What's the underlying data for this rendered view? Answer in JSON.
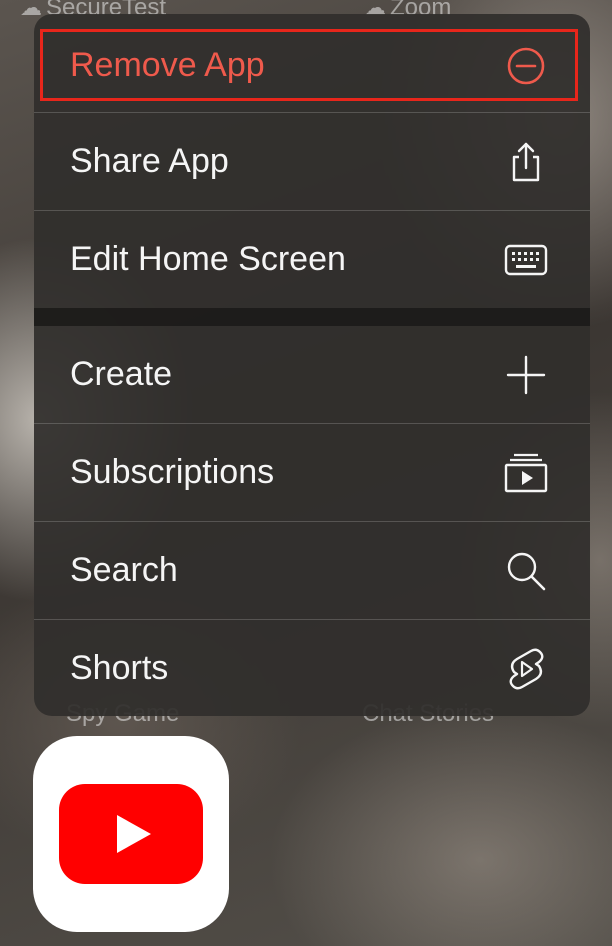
{
  "background_apps": {
    "top_left": "SecureTest",
    "top_right": "Zoom",
    "bottom_left": "Spy Game",
    "bottom_right": "Chat Stories"
  },
  "menu": {
    "items": [
      {
        "label": "Remove App",
        "icon": "minus-circle-icon",
        "destructive": true
      },
      {
        "label": "Share App",
        "icon": "share-icon"
      },
      {
        "label": "Edit Home Screen",
        "icon": "keyboard-icon"
      },
      {
        "label": "Create",
        "icon": "plus-icon"
      },
      {
        "label": "Subscriptions",
        "icon": "subscriptions-icon"
      },
      {
        "label": "Search",
        "icon": "search-icon"
      },
      {
        "label": "Shorts",
        "icon": "shorts-icon"
      }
    ]
  },
  "app": {
    "name": "YouTube",
    "icon": "youtube-icon"
  },
  "colors": {
    "destructive": "#ef5a4c",
    "highlight_box": "#e8261b",
    "youtube_red": "#ff0000"
  }
}
